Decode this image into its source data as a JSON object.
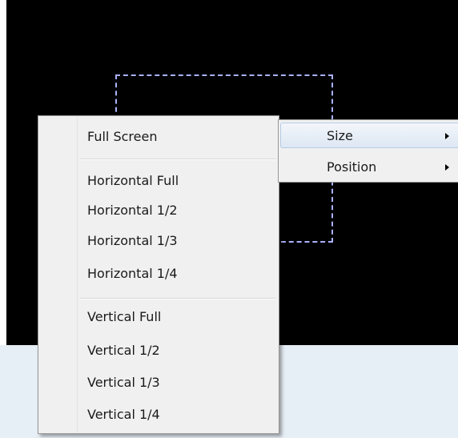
{
  "context_menu": {
    "items": [
      {
        "label": "Full Screen"
      },
      {
        "label": "Horizontal Full"
      },
      {
        "label": "Horizontal 1/2"
      },
      {
        "label": "Horizontal 1/3"
      },
      {
        "label": "Horizontal 1/4"
      },
      {
        "label": "Vertical Full"
      },
      {
        "label": "Vertical 1/2"
      },
      {
        "label": "Vertical 1/3"
      },
      {
        "label": "Vertical 1/4"
      }
    ]
  },
  "submenu": {
    "items": [
      {
        "label": "Size",
        "icon": "chevron-right-icon",
        "highlighted": true
      },
      {
        "label": "Position",
        "icon": "chevron-right-icon",
        "highlighted": false
      }
    ]
  },
  "colors": {
    "background": "#000000",
    "menu_background": "#f0f0f0",
    "highlight": "#dde7f3",
    "selection_border": "#aab2ff"
  }
}
